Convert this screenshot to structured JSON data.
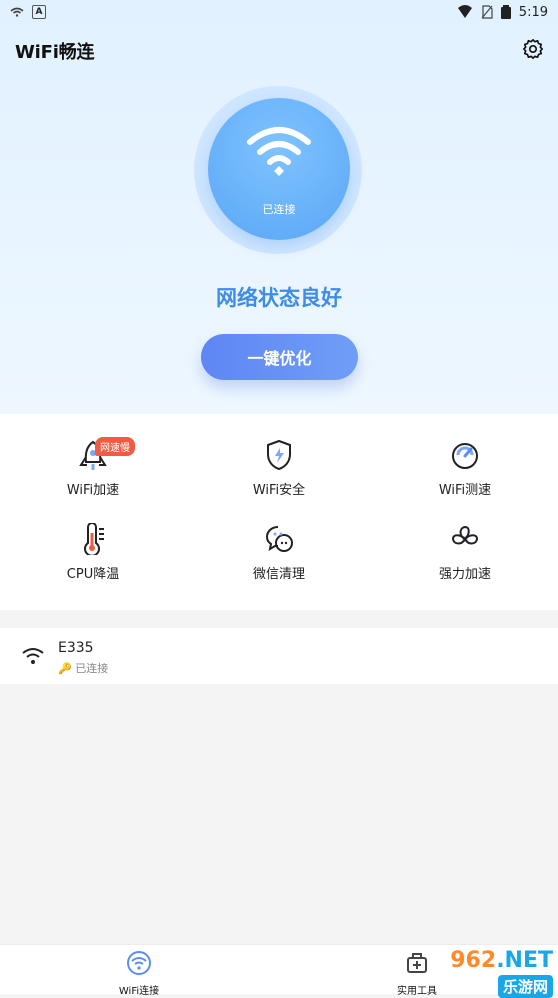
{
  "status_bar": {
    "time": "5:19",
    "left_icons": [
      "wifi-icon",
      "a-icon"
    ],
    "right_icons": [
      "wifi-signal-icon",
      "no-sim-icon",
      "battery-icon"
    ]
  },
  "header": {
    "title": "WiFi畅连",
    "settings_icon": "settings-icon"
  },
  "connection": {
    "status_label": "已连接",
    "headline": "网络状态良好",
    "optimize_button": "一键优化",
    "accent_color": "#3f8be8"
  },
  "tools": [
    {
      "label": "WiFi加速",
      "badge": "网速慢",
      "icon": "rocket-icon"
    },
    {
      "label": "WiFi安全",
      "icon": "shield-icon"
    },
    {
      "label": "WiFi测速",
      "icon": "speedometer-icon"
    },
    {
      "label": "CPU降温",
      "icon": "thermometer-icon"
    },
    {
      "label": "微信清理",
      "icon": "chat-icon"
    },
    {
      "label": "强力加速",
      "icon": "fan-icon"
    }
  ],
  "network": {
    "name": "E335",
    "status": "已连接",
    "key_icon": "key-icon"
  },
  "bottom_nav": [
    {
      "label": "WiFi连接",
      "icon": "wifi-tab-icon",
      "active": true
    },
    {
      "label": "实用工具",
      "icon": "toolbox-icon",
      "active": false
    }
  ],
  "watermark": {
    "left": "962",
    "right": ".NET",
    "subtitle": "乐游网"
  }
}
